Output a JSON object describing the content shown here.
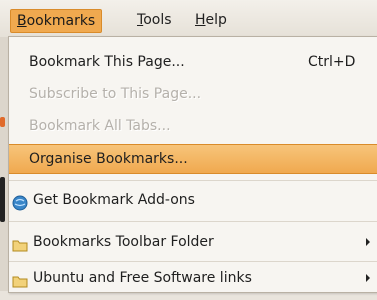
{
  "menubar": {
    "items": [
      {
        "label": "Bookmarks",
        "accel_char": "B",
        "rest": "ookmarks"
      },
      {
        "label": "Tools",
        "accel_char": "T",
        "rest": "ools"
      },
      {
        "label": "Help",
        "accel_char": "H",
        "rest": "elp"
      }
    ]
  },
  "menu": {
    "items": [
      {
        "label": "Bookmark This Page...",
        "accelerator": "Ctrl+D",
        "state": "enabled"
      },
      {
        "label": "Subscribe to This Page...",
        "state": "disabled"
      },
      {
        "label": "Bookmark All Tabs...",
        "state": "disabled"
      },
      {
        "label": "Organise Bookmarks...",
        "state": "highlighted"
      },
      {
        "label": "Get Bookmark Add-ons",
        "icon": "addons-globe-icon"
      },
      {
        "label": "Bookmarks Toolbar Folder",
        "icon": "folder-icon",
        "submenu": true
      },
      {
        "label": "Ubuntu and Free Software links",
        "icon": "folder-icon",
        "submenu": true
      }
    ]
  },
  "colors": {
    "highlight": "#f0a94f",
    "disabled_text": "#b5b1ab",
    "menu_bg": "#f7f5f1"
  }
}
